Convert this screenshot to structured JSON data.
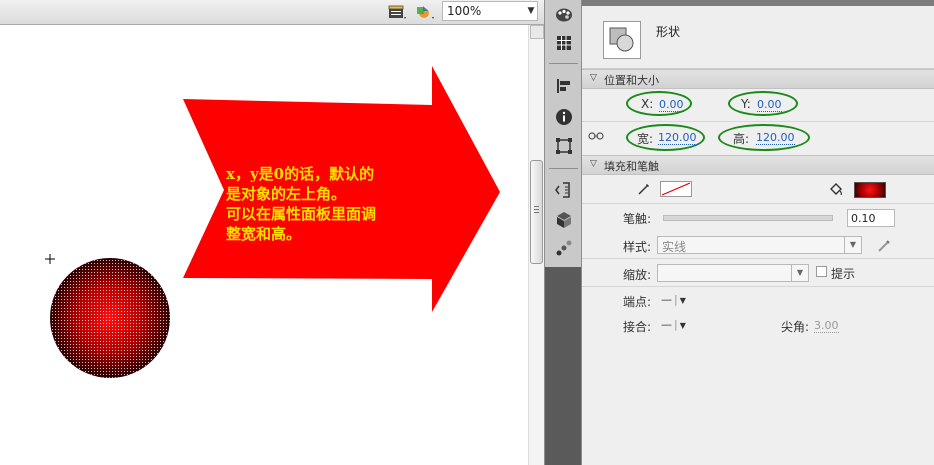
{
  "stage": {
    "zoom": "100%",
    "annotation": {
      "lines": [
        "x，y是0的话，默认的",
        "是对象的左上角。",
        "可以在属性面板里面调",
        "整宽和高。"
      ],
      "arrow_color": "#ff0000",
      "text_color": "#ffe000"
    },
    "registration_mark": "+"
  },
  "properties": {
    "shape_label": "形状",
    "position_section": "位置和大小",
    "x_label": "X:",
    "x_value": "0.00",
    "y_label": "Y:",
    "y_value": "0.00",
    "width_label": "宽:",
    "width_value": "120.00",
    "height_label": "高:",
    "height_value": "120.00",
    "fill_section": "填充和笔触",
    "stroke_label": "笔触:",
    "stroke_value": "0.10",
    "style_label": "样式:",
    "style_value": "实线",
    "scale_label": "缩放:",
    "hint_label": "提示",
    "cap_label": "端点:",
    "join_label": "接合:",
    "miter_label": "尖角:",
    "miter_value": "3.00",
    "highlight_color": "#1a8a1a"
  }
}
